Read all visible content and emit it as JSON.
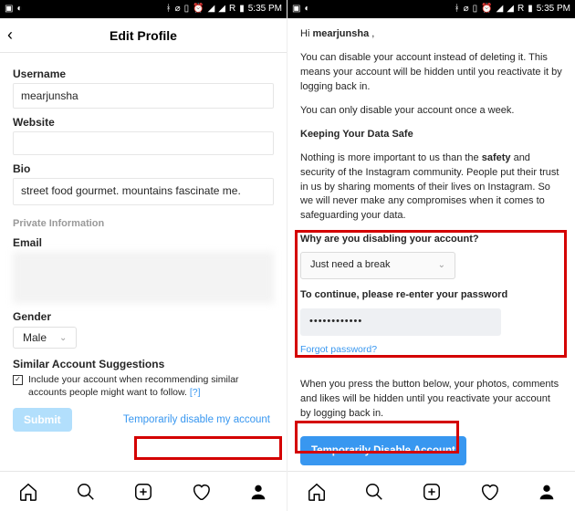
{
  "status": {
    "time": "5:35 PM",
    "net": "R"
  },
  "left": {
    "header": "Edit Profile",
    "labels": {
      "username": "Username",
      "website": "Website",
      "bio": "Bio",
      "private": "Private Information",
      "email": "Email",
      "gender": "Gender",
      "suggest": "Similar Account Suggestions"
    },
    "values": {
      "username": "mearjunsha",
      "bio": "street food gourmet. mountains fascinate me.",
      "gender": "Male"
    },
    "suggest_text": "Include your account when recommending similar accounts people might want to follow.",
    "suggest_help": "[?]",
    "submit": "Submit",
    "temp_disable": "Temporarily disable my account"
  },
  "right": {
    "greeting_pre": "Hi ",
    "greeting_name": "mearjunsha",
    "greeting_post": " ,",
    "p1": "You can disable your account instead of deleting it. This means your account will be hidden until you reactivate it by logging back in.",
    "p2": "You can only disable your account once a week.",
    "h1": "Keeping Your Data Safe",
    "p3_a": "Nothing is more important to us than the ",
    "p3_b": "safety",
    "p3_c": " and security of the Instagram community. People put their trust in us by sharing moments of their lives on Instagram. So we will never make any compromises when it comes to safeguarding your data.",
    "q1": "Why are you disabling your account?",
    "reason": "Just need a break",
    "q2": "To continue, please re-enter your password",
    "pwd": "••••••••••••",
    "forgot": "Forgot password?",
    "p4": "When you press the button below, your photos, comments and likes will be hidden until you reactivate your account by logging back in.",
    "btn": "Temporarily Disable Account"
  }
}
